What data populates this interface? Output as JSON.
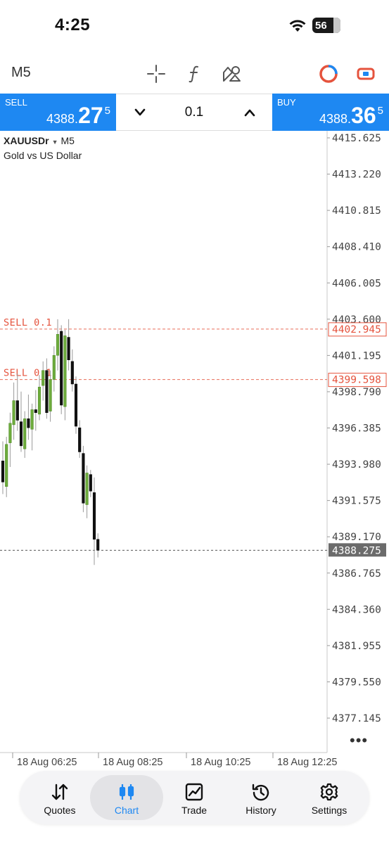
{
  "status_bar": {
    "time": "4:25",
    "battery": "56"
  },
  "toolbar": {
    "timeframe": "M5",
    "icons": [
      "crosshair-icon",
      "function-icon",
      "objects-icon",
      "one-click-trading-icon",
      "account-toggle-icon"
    ]
  },
  "trade": {
    "sell_label": "SELL",
    "sell_price_small": "4388.",
    "sell_price_big": "27",
    "sell_price_sup": "5",
    "buy_label": "BUY",
    "buy_price_small": "4388.",
    "buy_price_big": "36",
    "buy_price_sup": "5",
    "volume": "0.1"
  },
  "chart": {
    "symbol": "XAUUSDr",
    "timeframe": "M5",
    "description": "Gold vs US Dollar",
    "colors": {
      "bull": "#6dab3c",
      "bear": "#111111",
      "order_line": "#e5533d",
      "current_price_bg": "#6b6b6b"
    }
  },
  "chart_data": {
    "type": "candlestick",
    "y_ticks": [
      "4415.625",
      "4413.220",
      "4410.815",
      "4408.410",
      "4406.005",
      "4403.600",
      "4401.195",
      "4398.790",
      "4396.385",
      "4393.980",
      "4391.575",
      "4389.170",
      "4386.765",
      "4384.360",
      "4381.955",
      "4379.550",
      "4377.145"
    ],
    "ylim": [
      4375.9,
      4416.4
    ],
    "x_ticks": [
      "18 Aug 06:25",
      "18 Aug 08:25",
      "18 Aug 10:25",
      "18 Aug 12:25"
    ],
    "orders": [
      {
        "label": "SELL 0.1",
        "price": 4402.945,
        "price_label": "4402.945"
      },
      {
        "label": "SELL 0.1",
        "price": 4399.598,
        "price_label": "4399.598"
      }
    ],
    "current_price": 4388.275,
    "current_price_label": "4388.275",
    "candles": [
      {
        "o": 4394.2,
        "h": 4395.5,
        "l": 4392.0,
        "c": 4392.8
      },
      {
        "o": 4392.5,
        "h": 4395.8,
        "l": 4391.8,
        "c": 4395.3
      },
      {
        "o": 4395.4,
        "h": 4397.4,
        "l": 4393.8,
        "c": 4396.7
      },
      {
        "o": 4396.6,
        "h": 4399.4,
        "l": 4395.6,
        "c": 4398.2
      },
      {
        "o": 4398.2,
        "h": 4400.0,
        "l": 4396.2,
        "c": 4396.9
      },
      {
        "o": 4396.8,
        "h": 4398.8,
        "l": 4394.8,
        "c": 4395.2
      },
      {
        "o": 4395.0,
        "h": 4397.5,
        "l": 4394.4,
        "c": 4397.0
      },
      {
        "o": 4397.0,
        "h": 4398.6,
        "l": 4395.6,
        "c": 4396.4
      },
      {
        "o": 4396.3,
        "h": 4398.0,
        "l": 4394.9,
        "c": 4397.6
      },
      {
        "o": 4397.6,
        "h": 4398.9,
        "l": 4396.2,
        "c": 4397.4
      },
      {
        "o": 4397.3,
        "h": 4399.9,
        "l": 4396.9,
        "c": 4399.1
      },
      {
        "o": 4399.2,
        "h": 4400.8,
        "l": 4398.2,
        "c": 4400.2
      },
      {
        "o": 4400.2,
        "h": 4401.0,
        "l": 4397.0,
        "c": 4397.4
      },
      {
        "o": 4397.5,
        "h": 4400.2,
        "l": 4396.8,
        "c": 4399.6
      },
      {
        "o": 4399.6,
        "h": 4401.8,
        "l": 4398.8,
        "c": 4401.2
      },
      {
        "o": 4401.2,
        "h": 4403.6,
        "l": 4400.2,
        "c": 4402.6
      },
      {
        "o": 4402.8,
        "h": 4403.2,
        "l": 4397.3,
        "c": 4397.9
      },
      {
        "o": 4397.8,
        "h": 4402.9,
        "l": 4396.9,
        "c": 4402.5
      },
      {
        "o": 4402.4,
        "h": 4403.6,
        "l": 4400.2,
        "c": 4400.9
      },
      {
        "o": 4400.8,
        "h": 4401.6,
        "l": 4398.8,
        "c": 4399.3
      },
      {
        "o": 4399.3,
        "h": 4399.8,
        "l": 4396.0,
        "c": 4396.5
      },
      {
        "o": 4396.4,
        "h": 4396.9,
        "l": 4394.4,
        "c": 4394.8
      },
      {
        "o": 4394.7,
        "h": 4395.2,
        "l": 4390.8,
        "c": 4391.4
      },
      {
        "o": 4391.3,
        "h": 4393.9,
        "l": 4390.4,
        "c": 4393.4
      },
      {
        "o": 4393.3,
        "h": 4393.6,
        "l": 4391.8,
        "c": 4392.2
      },
      {
        "o": 4392.1,
        "h": 4393.1,
        "l": 4387.3,
        "c": 4389.0
      },
      {
        "o": 4389.0,
        "h": 4389.4,
        "l": 4387.8,
        "c": 4388.275
      }
    ]
  },
  "nav": {
    "items": [
      {
        "label": "Quotes",
        "icon": "quotes-icon"
      },
      {
        "label": "Chart",
        "icon": "chart-icon"
      },
      {
        "label": "Trade",
        "icon": "trade-icon"
      },
      {
        "label": "History",
        "icon": "history-icon"
      },
      {
        "label": "Settings",
        "icon": "settings-icon"
      }
    ],
    "active": "Chart"
  }
}
